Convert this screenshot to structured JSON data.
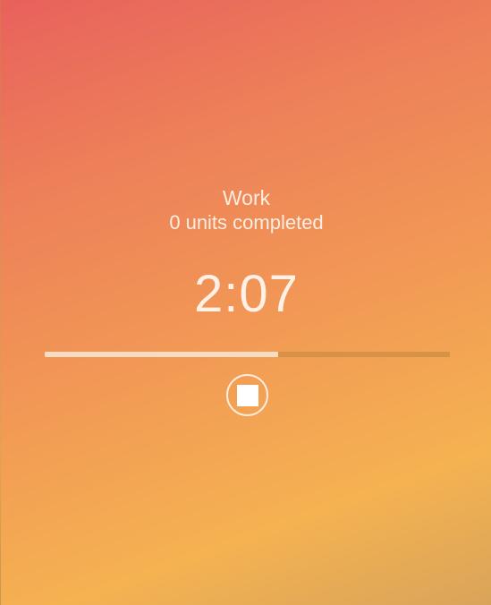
{
  "session": {
    "mode_label": "Work",
    "units_completed": "0",
    "units_label": "units completed"
  },
  "timer": {
    "display": "2:07"
  },
  "progress": {
    "fraction": 0.576
  },
  "controls": {
    "stop_icon": "stop-icon"
  },
  "colors": {
    "gradient_start": "#e8615c",
    "gradient_mid": "#f29a55",
    "gradient_end": "#f5b251",
    "progress_fill": "#f6dcc3",
    "progress_track": "#d89247"
  }
}
